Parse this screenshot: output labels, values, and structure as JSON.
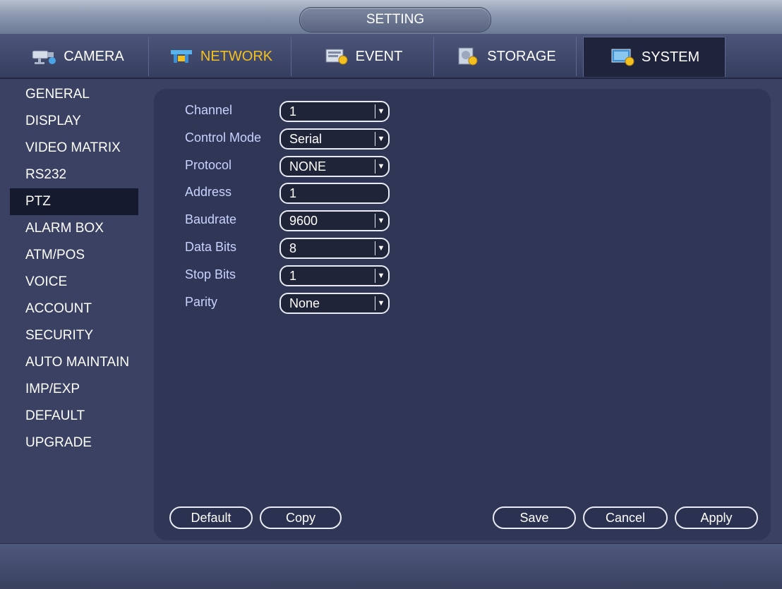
{
  "window": {
    "title": "SETTING"
  },
  "tabs": [
    {
      "label": "CAMERA",
      "icon": "camera-icon"
    },
    {
      "label": "NETWORK",
      "icon": "network-icon"
    },
    {
      "label": "EVENT",
      "icon": "event-icon"
    },
    {
      "label": "STORAGE",
      "icon": "storage-icon"
    },
    {
      "label": "SYSTEM",
      "icon": "system-icon"
    }
  ],
  "sidebar": {
    "items": [
      "GENERAL",
      "DISPLAY",
      "VIDEO MATRIX",
      "RS232",
      "PTZ",
      "ALARM BOX",
      "ATM/POS",
      "VOICE",
      "ACCOUNT",
      "SECURITY",
      "AUTO MAINTAIN",
      "IMP/EXP",
      "DEFAULT",
      "UPGRADE"
    ],
    "active": "PTZ"
  },
  "ptz": {
    "fields": [
      {
        "label": "Channel",
        "value": "1",
        "type": "dropdown"
      },
      {
        "label": "Control Mode",
        "value": "Serial",
        "type": "dropdown"
      },
      {
        "label": "Protocol",
        "value": "NONE",
        "type": "dropdown"
      },
      {
        "label": "Address",
        "value": "1",
        "type": "input"
      },
      {
        "label": "Baudrate",
        "value": "9600",
        "type": "dropdown"
      },
      {
        "label": "Data Bits",
        "value": "8",
        "type": "dropdown"
      },
      {
        "label": "Stop Bits",
        "value": "1",
        "type": "dropdown"
      },
      {
        "label": "Parity",
        "value": "None",
        "type": "dropdown"
      }
    ]
  },
  "buttons": {
    "default": "Default",
    "copy": "Copy",
    "save": "Save",
    "cancel": "Cancel",
    "apply": "Apply"
  },
  "colors": {
    "background": "#3a4163",
    "panel": "#2f3656",
    "active_tab_text": "#f3c01d",
    "field_label": "#c7d4ff",
    "active_sidebar": "#151a2f"
  }
}
